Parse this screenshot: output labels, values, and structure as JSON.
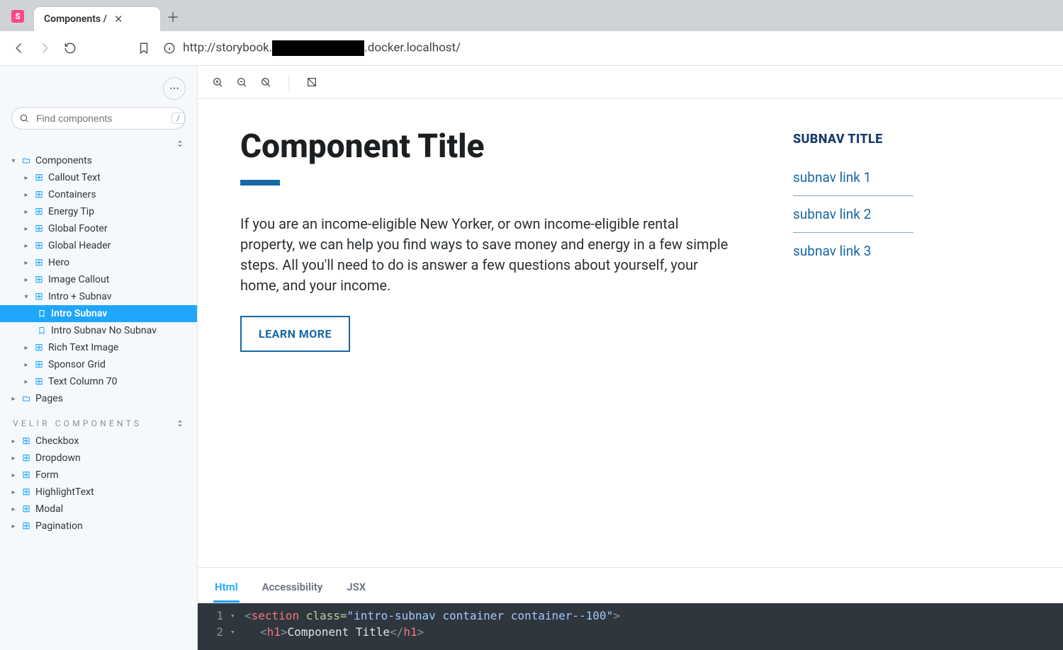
{
  "browser": {
    "tab_title": "Components /",
    "url_prefix": "http://storybook.",
    "url_suffix": ".docker.localhost/"
  },
  "sidebar": {
    "search_placeholder": "Find components",
    "search_shortcut": "/",
    "root_label": "Components",
    "items": [
      {
        "label": "Callout Text"
      },
      {
        "label": "Containers"
      },
      {
        "label": "Energy Tip"
      },
      {
        "label": "Global Footer"
      },
      {
        "label": "Global Header"
      },
      {
        "label": "Hero"
      },
      {
        "label": "Image Callout"
      },
      {
        "label": "Intro + Subnav",
        "expanded": true,
        "children": [
          {
            "label": "Intro Subnav",
            "selected": true
          },
          {
            "label": "Intro Subnav No Subnav"
          }
        ]
      },
      {
        "label": "Rich Text Image"
      },
      {
        "label": "Sponsor Grid"
      },
      {
        "label": "Text Column 70"
      }
    ],
    "pages_label": "Pages",
    "section_label": "VELIR COMPONENTS",
    "velir_items": [
      {
        "label": "Checkbox"
      },
      {
        "label": "Dropdown"
      },
      {
        "label": "Form"
      },
      {
        "label": "HighlightText"
      },
      {
        "label": "Modal"
      },
      {
        "label": "Pagination"
      }
    ]
  },
  "component": {
    "title": "Component Title",
    "body": "If you are an income-eligible New Yorker, or own income-eligible rental property, we can help you find ways to save money and energy in a few simple steps. All you'll need to do is answer a few questions about yourself, your home, and your income.",
    "cta_label": "LEARN MORE",
    "subnav_title": "SUBNAV TITLE",
    "subnav_links": [
      "subnav link 1",
      "subnav link 2",
      "subnav link 3"
    ]
  },
  "addons": {
    "tabs": [
      "Html",
      "Accessibility",
      "JSX"
    ],
    "active_tab": "Html",
    "code": {
      "line1": {
        "open": "<",
        "tag": "section",
        "attr": " class=",
        "str": "\"intro-subnav container container--100\"",
        "close": ">"
      },
      "line2": {
        "open": "<",
        "tag": "h1",
        "gt": ">",
        "text": "Component Title",
        "open2": "</",
        "tag2": "h1",
        "close": ">"
      }
    }
  }
}
